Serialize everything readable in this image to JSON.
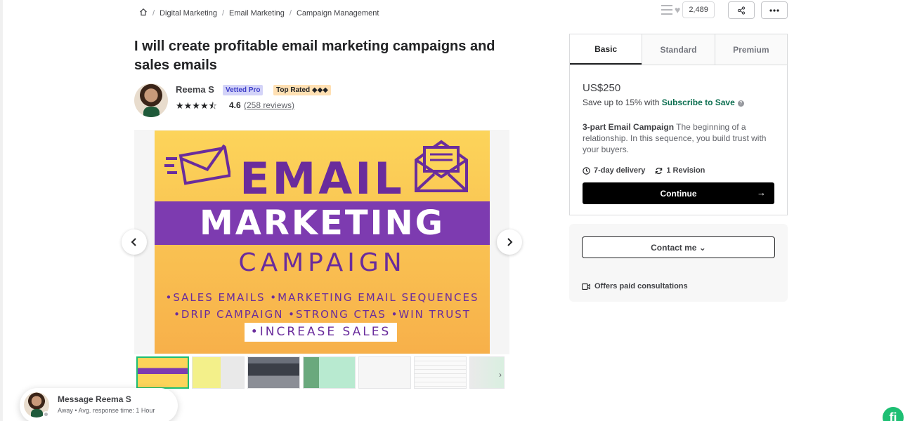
{
  "breadcrumb": {
    "items": [
      "Digital Marketing",
      "Email Marketing",
      "Campaign Management"
    ]
  },
  "actions": {
    "likes_count": "2,489"
  },
  "gig": {
    "title": "I will create profitable email marketing campaigns and sales emails"
  },
  "seller": {
    "name": "Reema S",
    "vetted_badge": "Vetted Pro",
    "top_badge": "Top Rated ◆◆◆",
    "stars": "★★★★⯪",
    "rating": "4.6",
    "reviews": "(258 reviews)"
  },
  "gallery": {
    "headline1": "EMAIL",
    "headline2": "MARKETING",
    "headline3": "CAMPAIGN",
    "line1": "•SALES EMAILS •MARKETING EMAIL SEQUENCES",
    "line2": "•DRIP CAMPAIGN •STRONG CTAS •WIN TRUST",
    "line3": "•INCREASE SALES"
  },
  "packages": {
    "tabs": [
      "Basic",
      "Standard",
      "Premium"
    ],
    "price": "US$250",
    "save_text": "Save up to 15% with ",
    "save_link": "Subscribe to Save",
    "desc_title": "3-part Email Campaign",
    "desc_body": " The beginning of a relationship. In this sequence, you build trust with your buyers.",
    "delivery": "7-day delivery",
    "revisions": "1 Revision",
    "continue_label": "Continue",
    "continue_arrow": "→"
  },
  "contact": {
    "button": "Contact me ⌄",
    "paid": "Offers paid consultations"
  },
  "message": {
    "name": "Message Reema S",
    "status": "Away  •  Avg. response time: 1 Hour"
  },
  "colors": {
    "accent": "#1dbf73",
    "link": "#0b6e4f",
    "slide_purple": "#6a2c9c",
    "slide_yellow": "#fcd45a"
  }
}
